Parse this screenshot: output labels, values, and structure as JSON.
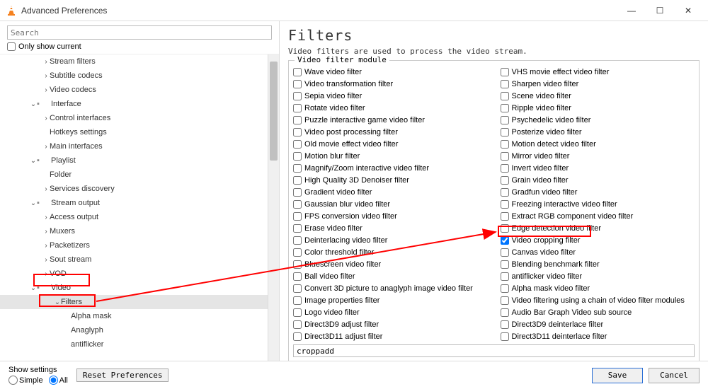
{
  "window": {
    "title": "Advanced Preferences"
  },
  "sidebar": {
    "search_placeholder": "Search",
    "only_current_label": "Only show current",
    "tree": [
      {
        "label": "Stream filters",
        "chev": "›",
        "cls": "indent0"
      },
      {
        "label": "Subtitle codecs",
        "chev": "›",
        "cls": "indent0"
      },
      {
        "label": "Video codecs",
        "chev": "›",
        "cls": "indent0"
      },
      {
        "label": "Interface",
        "chev": "⌄",
        "cls": "indent-top",
        "icon": true
      },
      {
        "label": "Control interfaces",
        "chev": "›",
        "cls": "indent0"
      },
      {
        "label": "Hotkeys settings",
        "chev": "",
        "cls": "indent0"
      },
      {
        "label": "Main interfaces",
        "chev": "›",
        "cls": "indent0"
      },
      {
        "label": "Playlist",
        "chev": "⌄",
        "cls": "indent-top",
        "icon": true
      },
      {
        "label": "Folder",
        "chev": "",
        "cls": "indent0"
      },
      {
        "label": "Services discovery",
        "chev": "›",
        "cls": "indent0"
      },
      {
        "label": "Stream output",
        "chev": "⌄",
        "cls": "indent-top",
        "icon": true
      },
      {
        "label": "Access output",
        "chev": "›",
        "cls": "indent0"
      },
      {
        "label": "Muxers",
        "chev": "›",
        "cls": "indent0"
      },
      {
        "label": "Packetizers",
        "chev": "›",
        "cls": "indent0"
      },
      {
        "label": "Sout stream",
        "chev": "›",
        "cls": "indent0"
      },
      {
        "label": "VOD",
        "chev": "›",
        "cls": "indent0"
      },
      {
        "label": "Video",
        "chev": "⌄",
        "cls": "indent-top",
        "icon": true
      },
      {
        "label": "Filters",
        "chev": "⌄",
        "cls": "indent1",
        "sel": true
      },
      {
        "label": "Alpha mask",
        "chev": "",
        "cls": "indent2"
      },
      {
        "label": "Anaglyph",
        "chev": "",
        "cls": "indent2"
      },
      {
        "label": "antiflicker",
        "chev": "",
        "cls": "indent2"
      }
    ]
  },
  "main": {
    "title": "Filters",
    "desc": "Video filters are used to process the video stream.",
    "legend": "Video filter module",
    "col1": [
      {
        "label": "Wave video filter",
        "checked": false
      },
      {
        "label": "Video transformation filter",
        "checked": false
      },
      {
        "label": "Sepia video filter",
        "checked": false
      },
      {
        "label": "Rotate video filter",
        "checked": false
      },
      {
        "label": "Puzzle interactive game video filter",
        "checked": false
      },
      {
        "label": "Video post processing filter",
        "checked": false
      },
      {
        "label": "Old movie effect video filter",
        "checked": false
      },
      {
        "label": "Motion blur filter",
        "checked": false
      },
      {
        "label": "Magnify/Zoom interactive video filter",
        "checked": false
      },
      {
        "label": "High Quality 3D Denoiser filter",
        "checked": false
      },
      {
        "label": "Gradient video filter",
        "checked": false
      },
      {
        "label": "Gaussian blur video filter",
        "checked": false
      },
      {
        "label": "FPS conversion video filter",
        "checked": false
      },
      {
        "label": "Erase video filter",
        "checked": false
      },
      {
        "label": "Deinterlacing video filter",
        "checked": false
      },
      {
        "label": "Color threshold filter",
        "checked": false
      },
      {
        "label": "Bluescreen video filter",
        "checked": false
      },
      {
        "label": "Ball video filter",
        "checked": false
      },
      {
        "label": "Convert 3D picture to anaglyph image video filter",
        "checked": false
      },
      {
        "label": "Image properties filter",
        "checked": false
      },
      {
        "label": "Logo video filter",
        "checked": false
      },
      {
        "label": "Direct3D9 adjust filter",
        "checked": false
      },
      {
        "label": "Direct3D11 adjust filter",
        "checked": false
      }
    ],
    "col2": [
      {
        "label": "VHS movie effect video filter",
        "checked": false
      },
      {
        "label": "Sharpen video filter",
        "checked": false
      },
      {
        "label": "Scene video filter",
        "checked": false
      },
      {
        "label": "Ripple video filter",
        "checked": false
      },
      {
        "label": "Psychedelic video filter",
        "checked": false
      },
      {
        "label": "Posterize video filter",
        "checked": false
      },
      {
        "label": "Motion detect video filter",
        "checked": false
      },
      {
        "label": "Mirror video filter",
        "checked": false
      },
      {
        "label": "Invert video filter",
        "checked": false
      },
      {
        "label": "Grain video filter",
        "checked": false
      },
      {
        "label": "Gradfun video filter",
        "checked": false
      },
      {
        "label": "Freezing interactive video filter",
        "checked": false
      },
      {
        "label": "Extract RGB component video filter",
        "checked": false
      },
      {
        "label": "Edge detection video filter",
        "checked": false
      },
      {
        "label": "Video cropping filter",
        "checked": true
      },
      {
        "label": "Canvas video filter",
        "checked": false
      },
      {
        "label": "Blending benchmark filter",
        "checked": false
      },
      {
        "label": "antiflicker video filter",
        "checked": false
      },
      {
        "label": "Alpha mask video filter",
        "checked": false
      },
      {
        "label": "Video filtering using a chain of video filter modules",
        "checked": false
      },
      {
        "label": "Audio Bar Graph Video sub source",
        "checked": false
      },
      {
        "label": "Direct3D9 deinterlace filter",
        "checked": false
      },
      {
        "label": "Direct3D11 deinterlace filter",
        "checked": false
      }
    ],
    "bottom_input": "croppadd"
  },
  "footer": {
    "show_settings_label": "Show settings",
    "simple": "Simple",
    "all": "All",
    "reset": "Reset Preferences",
    "save": "Save",
    "cancel": "Cancel"
  }
}
